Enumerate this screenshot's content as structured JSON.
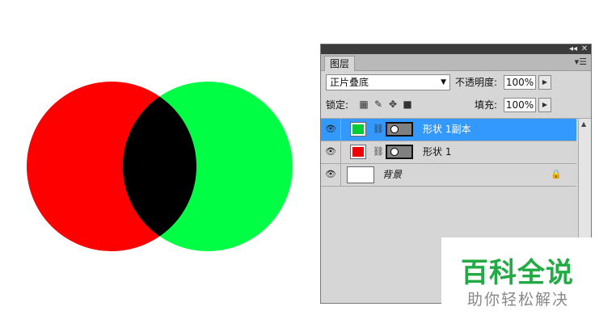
{
  "artwork": {
    "left_circle_color": "#ff0000",
    "right_circle_color": "#00ff44",
    "overlap_color": "#000000"
  },
  "panel": {
    "tab": "图层",
    "menu_icon": "panel-menu-icon",
    "blend_mode": "正片叠底",
    "opacity_label": "不透明度:",
    "opacity_value": "100%",
    "lock_label": "锁定:",
    "fill_label": "填充:",
    "fill_value": "100%",
    "layers": [
      {
        "name": "形状 1副本",
        "color": "#00cc33",
        "selected": true
      },
      {
        "name": "形状 1",
        "color": "#ee0000",
        "selected": false
      },
      {
        "name": "背景",
        "color": "#ffffff",
        "selected": false
      }
    ]
  },
  "watermark": {
    "title": "百科全说",
    "subtitle": "助你轻松解决"
  }
}
